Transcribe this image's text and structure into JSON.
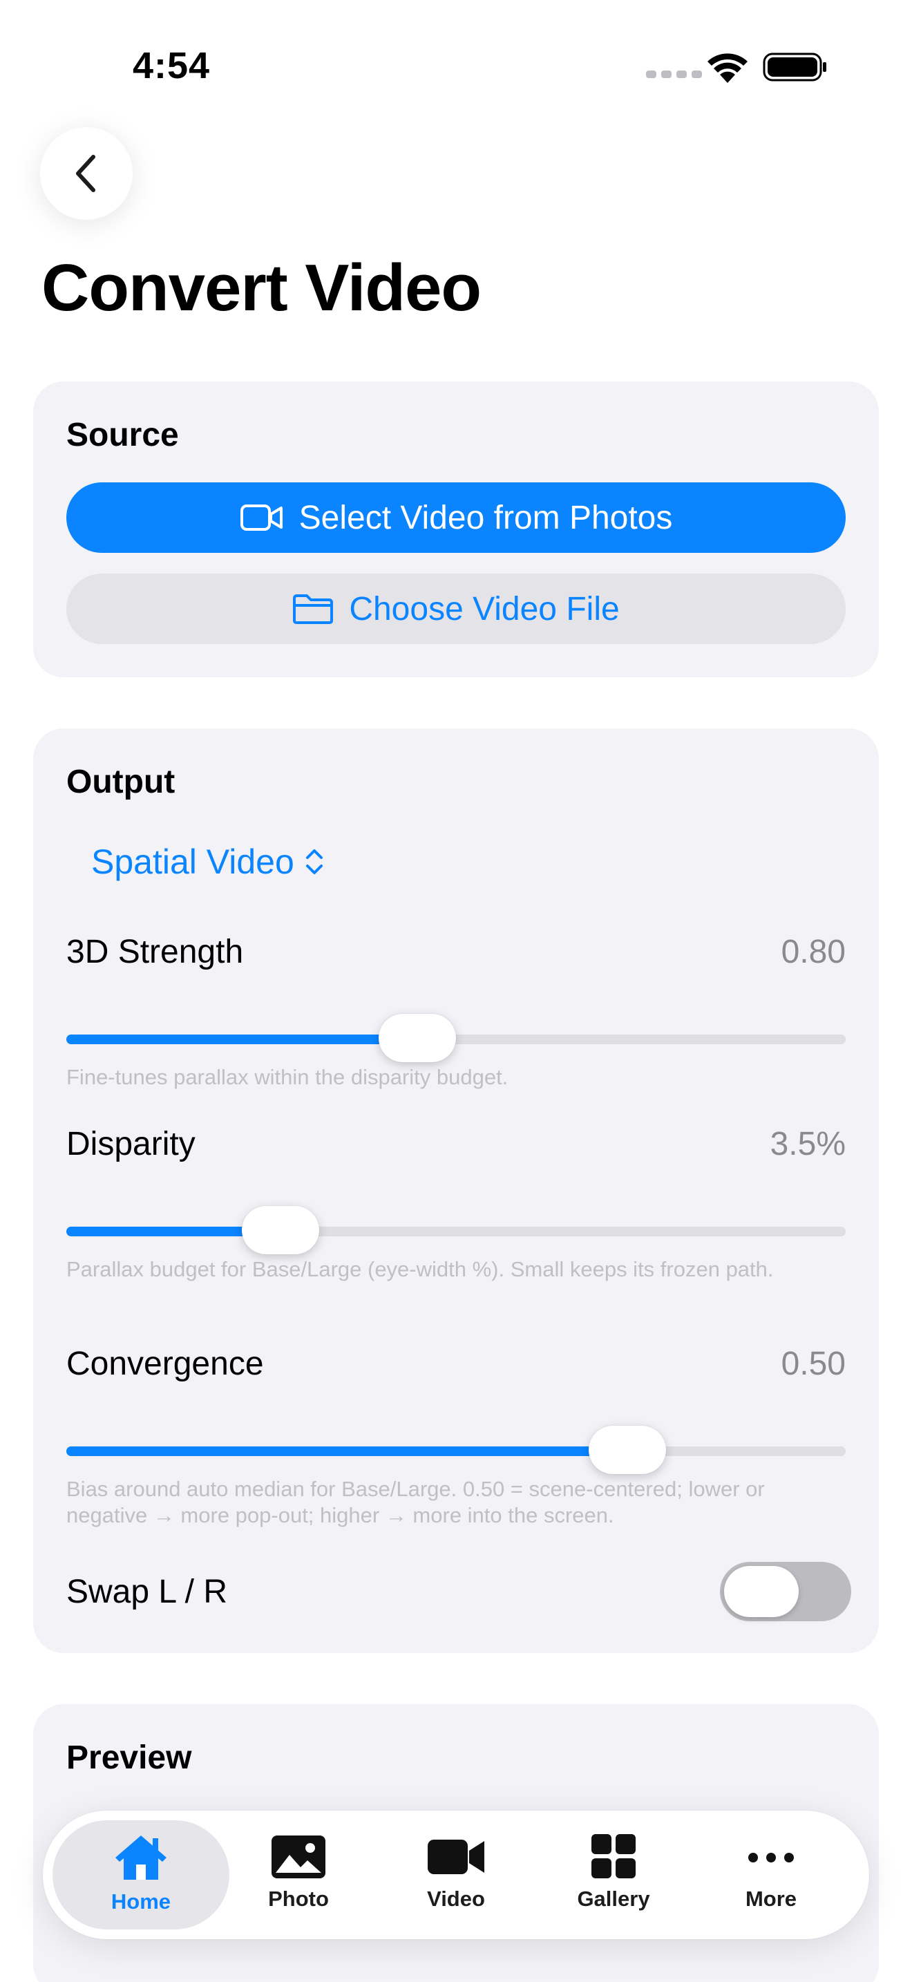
{
  "status": {
    "time": "4:54"
  },
  "page": {
    "title": "Convert Video"
  },
  "source": {
    "title": "Source",
    "select_photos_label": "Select Video from Photos",
    "choose_file_label": "Choose Video File"
  },
  "output": {
    "title": "Output",
    "format": "Spatial Video",
    "strength": {
      "label": "3D Strength",
      "value_text": "0.80",
      "fraction": 0.45,
      "help": "Fine-tunes parallax within the disparity budget."
    },
    "disparity": {
      "label": "Disparity",
      "value_text": "3.5%",
      "fraction": 0.275,
      "help": "Parallax budget for Base/Large (eye-width %). Small keeps its frozen path."
    },
    "convergence": {
      "label": "Convergence",
      "value_text": "0.50",
      "fraction": 0.72,
      "help": "Bias around auto median for Base/Large. 0.50 = scene-centered; lower or negative → more pop-out; higher → more into the screen."
    },
    "swap": {
      "label": "Swap L / R",
      "on": false
    }
  },
  "preview": {
    "title": "Preview"
  },
  "tabs": [
    {
      "label": "Home",
      "icon": "house-icon",
      "active": true
    },
    {
      "label": "Photo",
      "icon": "photo-icon",
      "active": false
    },
    {
      "label": "Video",
      "icon": "video-camera-icon",
      "active": false
    },
    {
      "label": "Gallery",
      "icon": "grid-icon",
      "active": false
    },
    {
      "label": "More",
      "icon": "ellipsis-icon",
      "active": false
    }
  ],
  "colors": {
    "accent": "#0a84ff",
    "card": "#f2f2f7",
    "secondary_button": "#e3e3e8"
  }
}
